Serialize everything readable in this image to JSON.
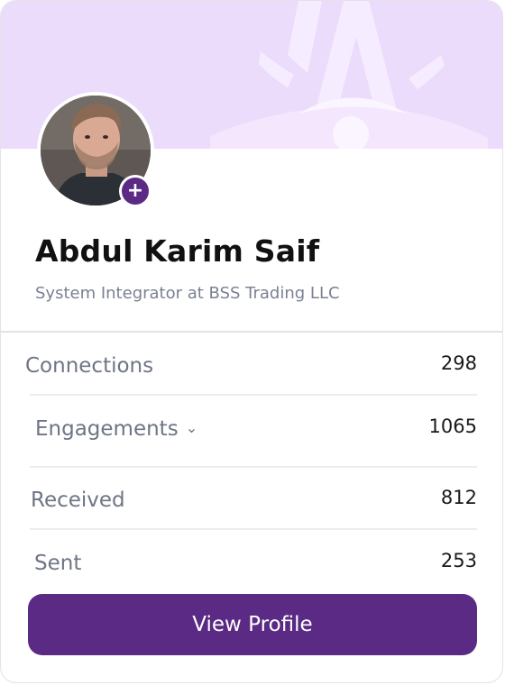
{
  "profile": {
    "name": "Abdul Karim Saif",
    "title": "System Integrator at BSS Trading LLC",
    "add_badge": "+"
  },
  "stats": [
    {
      "label": "Connections",
      "value": "298"
    },
    {
      "label": "Engagements",
      "value": "1065"
    },
    {
      "label": "Received",
      "value": "812"
    },
    {
      "label": "Sent",
      "value": "253"
    }
  ],
  "engagements_chevron": "⌄",
  "actions": {
    "view_profile": "View Profile"
  },
  "colors": {
    "banner": "#ecdcfb",
    "accent": "#5a2a84",
    "muted_text": "#6f7585"
  }
}
